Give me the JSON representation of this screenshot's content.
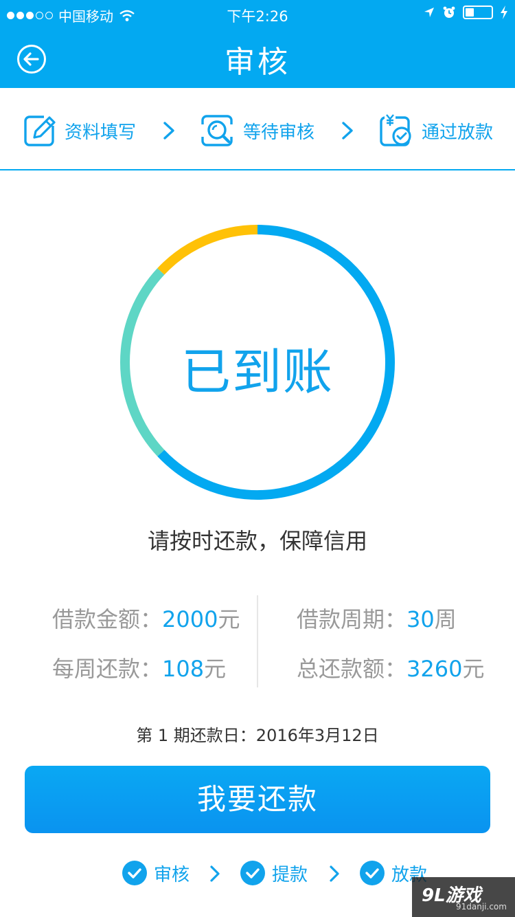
{
  "status_bar": {
    "carrier": "中国移动",
    "time": "下午2:26"
  },
  "header": {
    "title": "审核",
    "back_icon": "back-circle-icon"
  },
  "steps": [
    {
      "label": "资料填写",
      "icon": "edit-icon"
    },
    {
      "label": "等待审核",
      "icon": "search-review-icon"
    },
    {
      "label": "通过放款",
      "icon": "money-check-icon"
    }
  ],
  "ring": {
    "center_text": "已到账",
    "segments": [
      {
        "color": "#03a9f1",
        "fraction": 0.63
      },
      {
        "color": "#5ed6c5",
        "fraction": 0.24
      },
      {
        "color": "#ffc107",
        "fraction": 0.13
      }
    ]
  },
  "slogan": "请按时还款，保障信用",
  "loan": {
    "amount_label": "借款金额：",
    "amount_value": "2000",
    "amount_unit": "元",
    "period_label": "借款周期：",
    "period_value": "30",
    "period_unit": "周",
    "weekly_label": "每周还款：",
    "weekly_value": "108",
    "weekly_unit": "元",
    "total_label": "总还款额：",
    "total_value": "3260",
    "total_unit": "元"
  },
  "due_date": "第 1 期还款日：2016年3月12日",
  "pay_button": "我要还款",
  "progress": [
    {
      "label": "审核"
    },
    {
      "label": "提款"
    },
    {
      "label": "放款"
    }
  ],
  "watermark": {
    "main": "9L游戏",
    "sub": "91danji.com"
  },
  "colors": {
    "primary": "#03a9f1",
    "text_blue": "#11a3ec",
    "teal": "#5ed6c5",
    "yellow": "#ffc107"
  }
}
